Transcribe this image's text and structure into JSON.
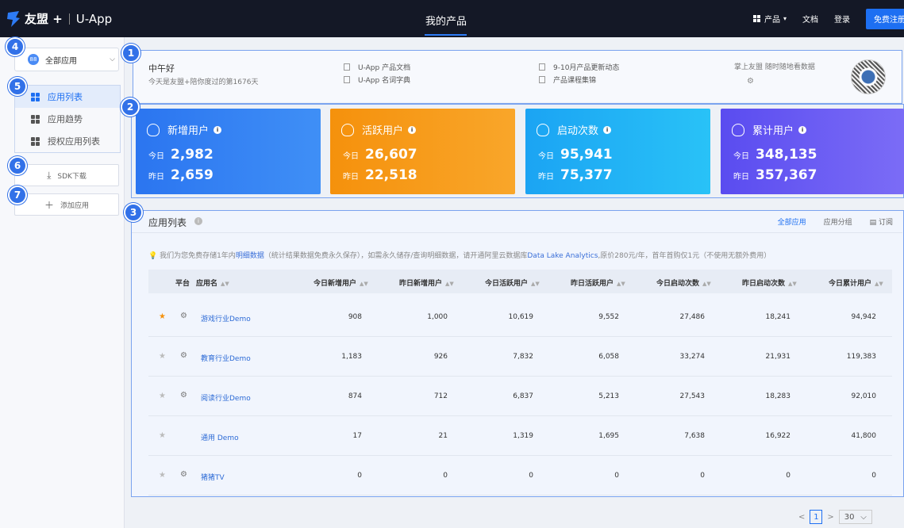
{
  "topbar": {
    "brand": "友盟 +",
    "app": "U-App",
    "title": "我的产品",
    "products": "产品",
    "docs": "文档",
    "login": "登录",
    "signup": "免费注册"
  },
  "sidebar": {
    "selector": "全部应用",
    "menu": [
      {
        "label": "应用列表",
        "active": true
      },
      {
        "label": "应用趋势",
        "active": false
      },
      {
        "label": "授权应用列表",
        "active": false
      }
    ],
    "sdk_download": "SDK下载",
    "add_app": "添加应用"
  },
  "badges": [
    "1",
    "2",
    "3",
    "4",
    "5",
    "6",
    "7"
  ],
  "greeting": {
    "hello": "中午好",
    "days": "今天是友盟+陪你度过的第1676天",
    "links": [
      "U-App 产品文档",
      "U-App 名词字典",
      "9-10月产品更新动态",
      "产品课程集锦"
    ],
    "mobile_text": "掌上友盟 随时随地看数据"
  },
  "cards": [
    {
      "title": "新增用户",
      "today_label": "今日",
      "today": "2,982",
      "yesterday_label": "昨日",
      "yesterday": "2,659"
    },
    {
      "title": "活跃用户",
      "today_label": "今日",
      "today": "26,607",
      "yesterday_label": "昨日",
      "yesterday": "22,518"
    },
    {
      "title": "启动次数",
      "today_label": "今日",
      "today": "95,941",
      "yesterday_label": "昨日",
      "yesterday": "75,377"
    },
    {
      "title": "累计用户",
      "today_label": "今日",
      "today": "348,135",
      "yesterday_label": "昨日",
      "yesterday": "357,367"
    }
  ],
  "app_list": {
    "title": "应用列表",
    "tabs": [
      "全部应用",
      "应用分组",
      "订阅"
    ],
    "notice_1": "我们为您免费存储1年内",
    "notice_link1": "明细数据",
    "notice_2": "（统计结果数据免费永久保存），如需永久储存/查询明细数据，请开通阿里云数据库",
    "notice_link2": "Data Lake Analytics",
    "notice_3": ",原价280元/年，首年首购仅1元（不使用无额外费用）",
    "columns": [
      "平台",
      "应用名",
      "今日新增用户",
      "昨日新增用户",
      "今日活跃用户",
      "昨日活跃用户",
      "今日启动次数",
      "昨日启动次数",
      "今日累计用户"
    ],
    "rows": [
      {
        "starred": true,
        "os": "android",
        "name": "游戏行业Demo",
        "values": [
          "908",
          "1,000",
          "10,619",
          "9,552",
          "27,486",
          "18,241",
          "94,942"
        ]
      },
      {
        "starred": false,
        "os": "android",
        "name": "教育行业Demo",
        "values": [
          "1,183",
          "926",
          "7,832",
          "6,058",
          "33,274",
          "21,931",
          "119,383"
        ]
      },
      {
        "starred": false,
        "os": "android",
        "name": "阅读行业Demo",
        "values": [
          "874",
          "712",
          "6,837",
          "5,213",
          "27,543",
          "18,283",
          "92,010"
        ]
      },
      {
        "starred": false,
        "os": "ios",
        "name": "通用 Demo",
        "values": [
          "17",
          "21",
          "1,319",
          "1,695",
          "7,638",
          "16,922",
          "41,800"
        ]
      },
      {
        "starred": false,
        "os": "android",
        "name": "猪猪TV",
        "values": [
          "0",
          "0",
          "0",
          "0",
          "0",
          "0",
          "0"
        ]
      }
    ]
  },
  "pager": {
    "page": "1",
    "size": "30"
  }
}
